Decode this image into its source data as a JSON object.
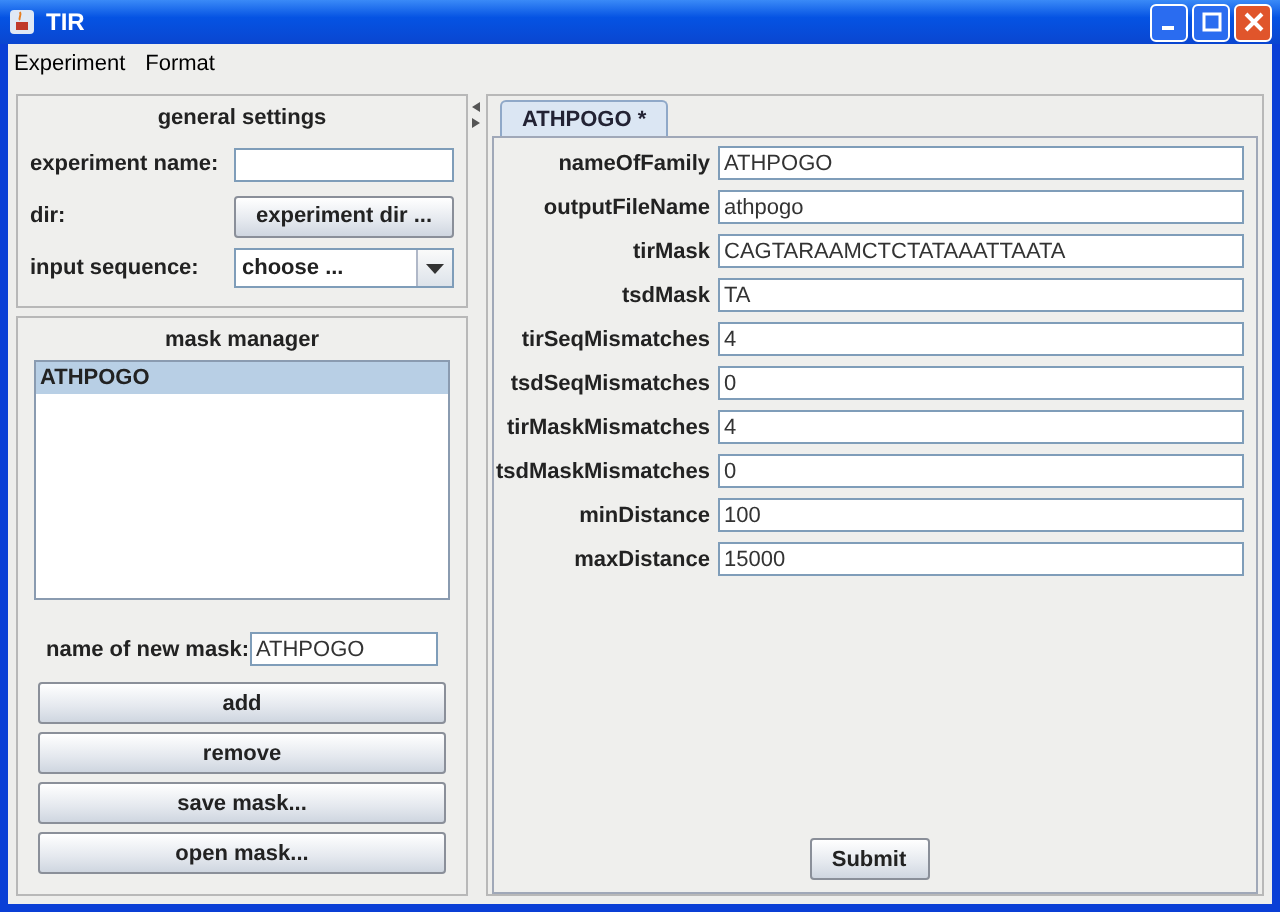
{
  "window": {
    "title": "TIR"
  },
  "menu": [
    "Experiment",
    "Format"
  ],
  "general_settings": {
    "title": "general settings",
    "rows": [
      {
        "label": "experiment name:",
        "kind": "text",
        "value": ""
      },
      {
        "label": "dir:",
        "kind": "button",
        "value": "experiment dir ..."
      },
      {
        "label": "input sequence:",
        "kind": "select",
        "value": "choose ..."
      }
    ]
  },
  "mask_manager": {
    "title": "mask manager",
    "items": [
      {
        "label": "ATHPOGO",
        "selected": true
      }
    ],
    "new_mask": {
      "label": "name of new mask:",
      "value": "ATHPOGO"
    },
    "buttons": [
      "add",
      "remove",
      "save mask...",
      "open mask..."
    ]
  },
  "tabs": [
    {
      "label": "ATHPOGO *",
      "selected": true
    }
  ],
  "form": [
    {
      "label": "nameOfFamily",
      "value": "ATHPOGO"
    },
    {
      "label": "outputFileName",
      "value": "athpogo"
    },
    {
      "label": "tirMask",
      "value": "CAGTARAAMCTCTATAAATTAATA"
    },
    {
      "label": "tsdMask",
      "value": "TA"
    },
    {
      "label": "tirSeqMismatches",
      "value": "4"
    },
    {
      "label": "tsdSeqMismatches",
      "value": "0"
    },
    {
      "label": "tirMaskMismatches",
      "value": "4"
    },
    {
      "label": "tsdMaskMismatches",
      "value": "0"
    },
    {
      "label": "minDistance",
      "value": "100"
    },
    {
      "label": "maxDistance",
      "value": "15000"
    }
  ],
  "submit": "Submit"
}
